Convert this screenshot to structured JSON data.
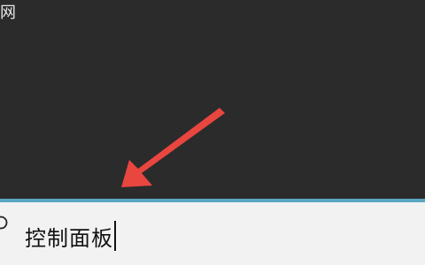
{
  "top_partial_text": "网",
  "search": {
    "value": "控制面板"
  },
  "colors": {
    "background": "#2b2b2b",
    "accent_border": "#5aa7c5",
    "arrow": "#e8463f",
    "search_bg": "#f2f2f2"
  },
  "icons": {
    "search": "search-icon",
    "annotation": "red-arrow-annotation"
  }
}
